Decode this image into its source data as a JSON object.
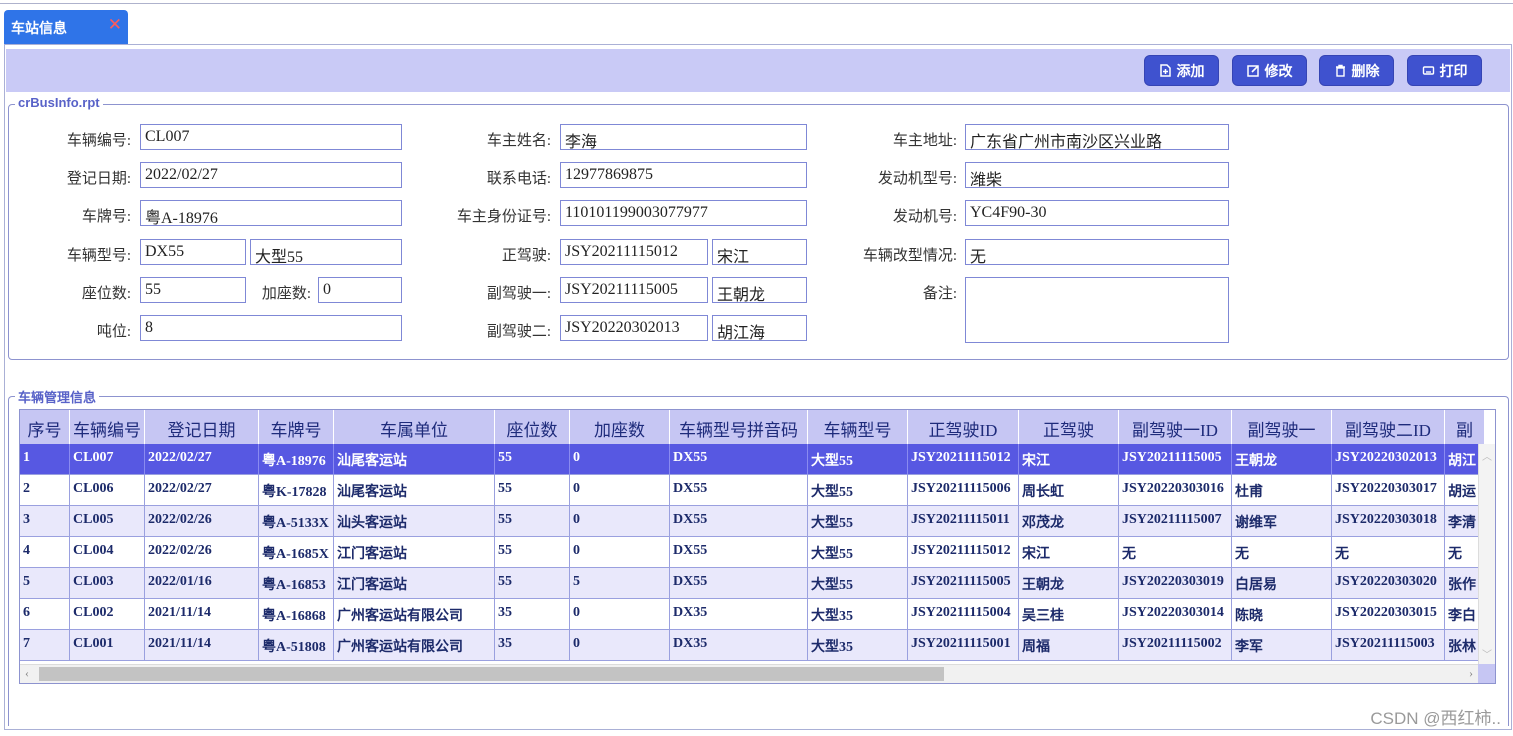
{
  "tab": {
    "label": "车站信息",
    "close": "✕"
  },
  "toolbar": {
    "add": "添加",
    "edit": "修改",
    "delete": "删除",
    "print": "打印"
  },
  "report": {
    "title": "crBusInfo.rpt",
    "fields": {
      "vehicle_no_label": "车辆编号:",
      "vehicle_no": "CL007",
      "reg_date_label": "登记日期:",
      "reg_date": "2022/02/27",
      "plate_label": "车牌号:",
      "plate": "粤A-18976",
      "model_label": "车辆型号:",
      "model_code": "DX55",
      "model_name": "大型55",
      "seats_label": "座位数:",
      "seats": "55",
      "extra_seats_label": "加座数:",
      "extra_seats": "0",
      "tonnage_label": "吨位:",
      "tonnage": "8",
      "owner_name_label": "车主姓名:",
      "owner_name": "李海",
      "phone_label": "联系电话:",
      "phone": "12977869875",
      "owner_id_label": "车主身份证号:",
      "owner_id": "110101199003077977",
      "driver_label": "正驾驶:",
      "driver_id": "JSY20211115012",
      "driver_name": "宋江",
      "codriver1_label": "副驾驶一:",
      "codriver1_id": "JSY20211115005",
      "codriver1_name": "王朝龙",
      "codriver2_label": "副驾驶二:",
      "codriver2_id": "JSY20220302013",
      "codriver2_name": "胡江海",
      "owner_addr_label": "车主地址:",
      "owner_addr": "广东省广州市南沙区兴业路",
      "engine_model_label": "发动机型号:",
      "engine_model": "潍柴",
      "engine_no_label": "发动机号:",
      "engine_no": "YC4F90-30",
      "modify_label": "车辆改型情况:",
      "modify": "无",
      "note_label": "备注:",
      "note": ""
    }
  },
  "grid": {
    "title": "车辆管理信息",
    "columns": [
      "序号",
      "车辆编号",
      "登记日期",
      "车牌号",
      "车属单位",
      "座位数",
      "加座数",
      "车辆型号拼音码",
      "车辆型号",
      "正驾驶ID",
      "正驾驶",
      "副驾驶一ID",
      "副驾驶一",
      "副驾驶二ID",
      "副"
    ],
    "rows": [
      [
        "1",
        "CL007",
        "2022/02/27",
        "粤A-18976",
        "汕尾客运站",
        "55",
        "0",
        "DX55",
        "大型55",
        "JSY20211115012",
        "宋江",
        "JSY20211115005",
        "王朝龙",
        "JSY20220302013",
        "胡江"
      ],
      [
        "2",
        "CL006",
        "2022/02/27",
        "粤K-17828",
        "汕尾客运站",
        "55",
        "0",
        "DX55",
        "大型55",
        "JSY20211115006",
        "周长虹",
        "JSY20220303016",
        "杜甫",
        "JSY20220303017",
        "胡运"
      ],
      [
        "3",
        "CL005",
        "2022/02/26",
        "粤A-5133X",
        "汕头客运站",
        "55",
        "0",
        "DX55",
        "大型55",
        "JSY20211115011",
        "邓茂龙",
        "JSY20211115007",
        "谢维军",
        "JSY20220303018",
        "李清"
      ],
      [
        "4",
        "CL004",
        "2022/02/26",
        "粤A-1685X",
        "江门客运站",
        "55",
        "0",
        "DX55",
        "大型55",
        "JSY20211115012",
        "宋江",
        "无",
        "无",
        "无",
        "无"
      ],
      [
        "5",
        "CL003",
        "2022/01/16",
        "粤A-16853",
        "江门客运站",
        "55",
        "5",
        "DX55",
        "大型55",
        "JSY20211115005",
        "王朝龙",
        "JSY20220303019",
        "白居易",
        "JSY20220303020",
        "张作"
      ],
      [
        "6",
        "CL002",
        "2021/11/14",
        "粤A-16868",
        "广州客运站有限公司",
        "35",
        "0",
        "DX35",
        "大型35",
        "JSY20211115004",
        "吴三桂",
        "JSY20220303014",
        "陈晓",
        "JSY20220303015",
        "李白"
      ],
      [
        "7",
        "CL001",
        "2021/11/14",
        "粤A-51808",
        "广州客运站有限公司",
        "35",
        "0",
        "DX35",
        "大型35",
        "JSY20211115001",
        "周福",
        "JSY20211115002",
        "李军",
        "JSY20211115003",
        "张林"
      ]
    ],
    "selected_row": 1
  },
  "watermark": "CSDN @西红柿.."
}
